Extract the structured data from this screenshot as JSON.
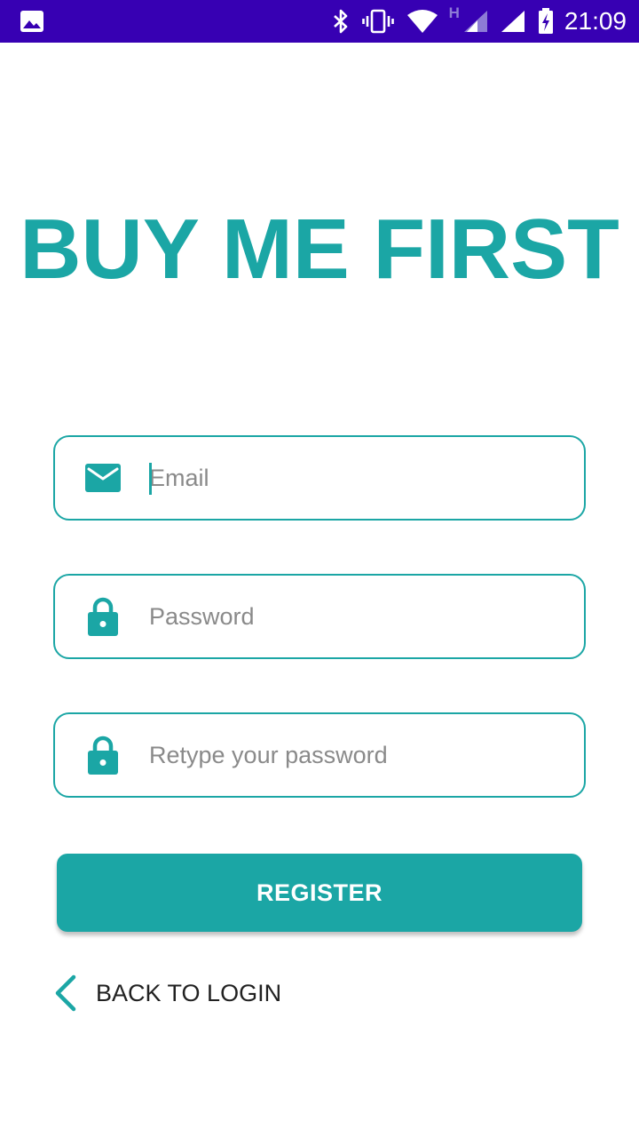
{
  "status_bar": {
    "time": "21:09",
    "network_type": "H",
    "icons": [
      "gallery-icon",
      "bluetooth-icon",
      "vibrate-icon",
      "wifi-icon",
      "signal-icon",
      "signal-icon",
      "battery-charging-icon"
    ]
  },
  "app": {
    "title": "BUY ME FIRST"
  },
  "form": {
    "email": {
      "value": "",
      "placeholder": "Email",
      "icon": "mail-icon"
    },
    "password": {
      "value": "",
      "placeholder": "Password",
      "icon": "lock-icon"
    },
    "retype_password": {
      "value": "",
      "placeholder": "Retype your password",
      "icon": "lock-icon"
    },
    "register_label": "REGISTER",
    "back_label": "BACK TO LOGIN"
  },
  "colors": {
    "accent": "#1ba6a5",
    "status_bar": "#3700b3"
  }
}
